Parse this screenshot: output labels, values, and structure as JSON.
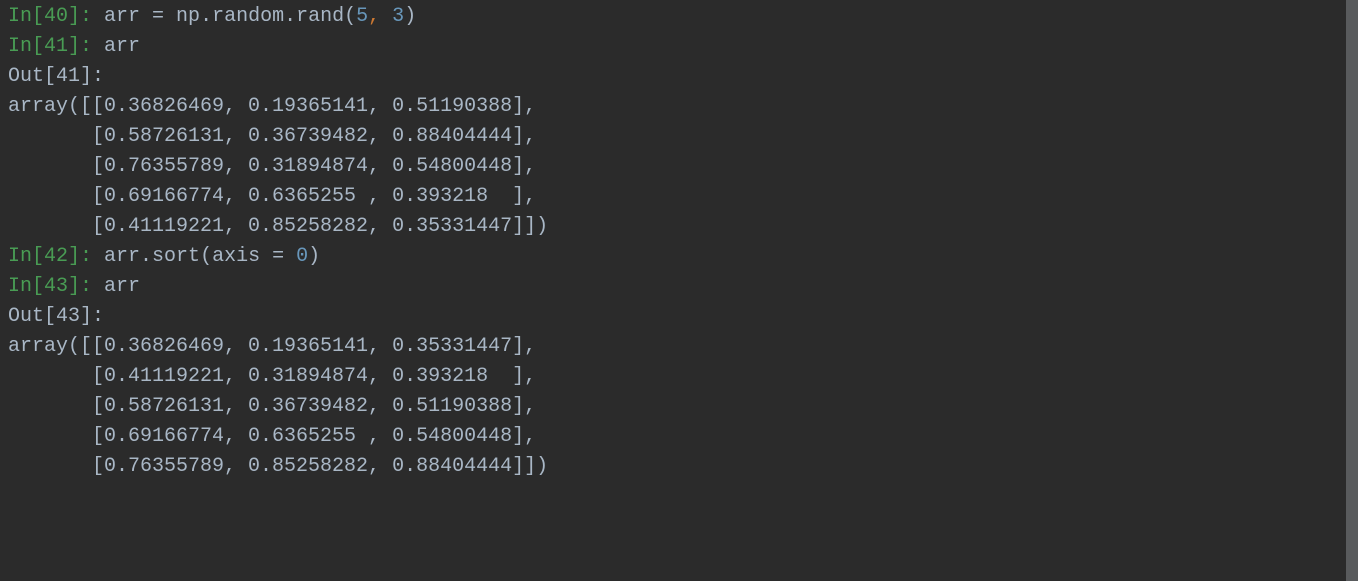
{
  "lines": {
    "l1_prompt": "In[40]:",
    "l1_code_a": " arr ",
    "l1_code_b": "=",
    "l1_code_c": " np",
    "l1_code_d": ".",
    "l1_code_e": "random",
    "l1_code_f": ".",
    "l1_code_g": "rand",
    "l1_code_h": "(",
    "l1_code_i": "5",
    "l1_code_j": ", ",
    "l1_code_k": "3",
    "l1_code_l": ")",
    "l2_prompt": "In[41]:",
    "l2_code": " arr",
    "l3_prompt": "Out[41]:",
    "l4": "array([[0.36826469, 0.19365141, 0.51190388],",
    "l5": "       [0.58726131, 0.36739482, 0.88404444],",
    "l6": "       [0.76355789, 0.31894874, 0.54800448],",
    "l7": "       [0.69166774, 0.6365255 , 0.393218  ],",
    "l8": "       [0.41119221, 0.85258282, 0.35331447]])",
    "l9_prompt": "In[42]:",
    "l9_code_a": " arr",
    "l9_code_b": ".",
    "l9_code_c": "sort",
    "l9_code_d": "(",
    "l9_code_e": "axis ",
    "l9_code_f": "=",
    "l9_code_g": " ",
    "l9_code_h": "0",
    "l9_code_i": ")",
    "l10_prompt": "In[43]:",
    "l10_code": " arr",
    "l11_prompt": "Out[43]:",
    "l12": "array([[0.36826469, 0.19365141, 0.35331447],",
    "l13": "       [0.41119221, 0.31894874, 0.393218  ],",
    "l14": "       [0.58726131, 0.36739482, 0.51190388],",
    "l15": "       [0.69166774, 0.6365255 , 0.54800448],",
    "l16": "       [0.76355789, 0.85258282, 0.88404444]])"
  }
}
